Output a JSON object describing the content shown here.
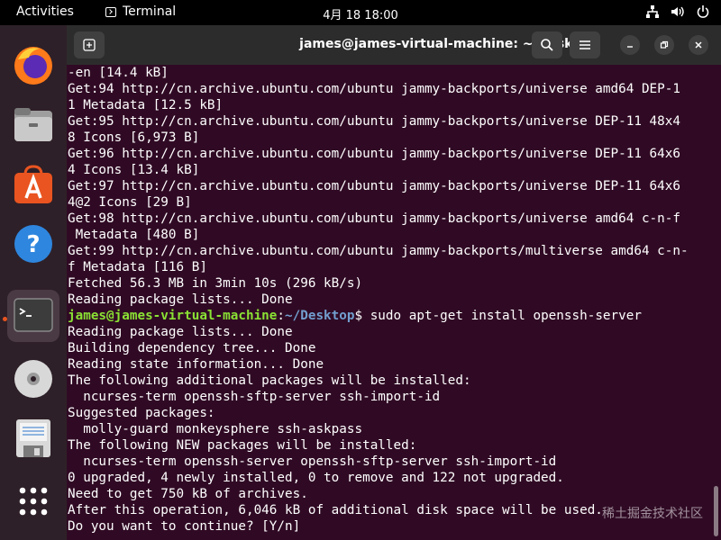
{
  "topbar": {
    "activities": "Activities",
    "app_name": "Terminal",
    "clock": "4月 18  18:00",
    "tray_icons": [
      "network-icon",
      "volume-icon",
      "power-icon"
    ]
  },
  "dock": {
    "items": [
      {
        "name": "firefox-icon"
      },
      {
        "name": "files-icon"
      },
      {
        "name": "app-center-icon"
      },
      {
        "name": "help-icon"
      },
      {
        "name": "terminal-icon",
        "active": true
      },
      {
        "name": "disc-icon"
      },
      {
        "name": "floppy-icon"
      },
      {
        "name": "show-apps-icon"
      }
    ]
  },
  "window": {
    "title": "james@james-virtual-machine: ~/Desktop",
    "prompt_user": "james@james-virtual-machine",
    "prompt_path": "~/Desktop",
    "prompt_sep": ":",
    "prompt_end": "$ ",
    "command": "sudo apt-get install openssh-server",
    "lines_before": [
      "-en [14.4 kB]",
      "Get:94 http://cn.archive.ubuntu.com/ubuntu jammy-backports/universe amd64 DEP-1",
      "1 Metadata [12.5 kB]",
      "Get:95 http://cn.archive.ubuntu.com/ubuntu jammy-backports/universe DEP-11 48x4",
      "8 Icons [6,973 B]",
      "Get:96 http://cn.archive.ubuntu.com/ubuntu jammy-backports/universe DEP-11 64x6",
      "4 Icons [13.4 kB]",
      "Get:97 http://cn.archive.ubuntu.com/ubuntu jammy-backports/universe DEP-11 64x6",
      "4@2 Icons [29 B]",
      "Get:98 http://cn.archive.ubuntu.com/ubuntu jammy-backports/universe amd64 c-n-f",
      " Metadata [480 B]",
      "Get:99 http://cn.archive.ubuntu.com/ubuntu jammy-backports/multiverse amd64 c-n-",
      "f Metadata [116 B]",
      "Fetched 56.3 MB in 3min 10s (296 kB/s)",
      "Reading package lists... Done"
    ],
    "lines_after": [
      "Reading package lists... Done",
      "Building dependency tree... Done",
      "Reading state information... Done",
      "The following additional packages will be installed:",
      "  ncurses-term openssh-sftp-server ssh-import-id",
      "Suggested packages:",
      "  molly-guard monkeysphere ssh-askpass",
      "The following NEW packages will be installed:",
      "  ncurses-term openssh-server openssh-sftp-server ssh-import-id",
      "0 upgraded, 4 newly installed, 0 to remove and 122 not upgraded.",
      "Need to get 750 kB of archives.",
      "After this operation, 6,046 kB of additional disk space will be used.",
      "Do you want to continue? [Y/n]"
    ]
  },
  "watermark": "稀土掘金技术社区",
  "colors": {
    "terminal_bg": "#300a24",
    "prompt_user": "#8ae234",
    "prompt_path": "#729fcf",
    "accent": "#e95420"
  }
}
